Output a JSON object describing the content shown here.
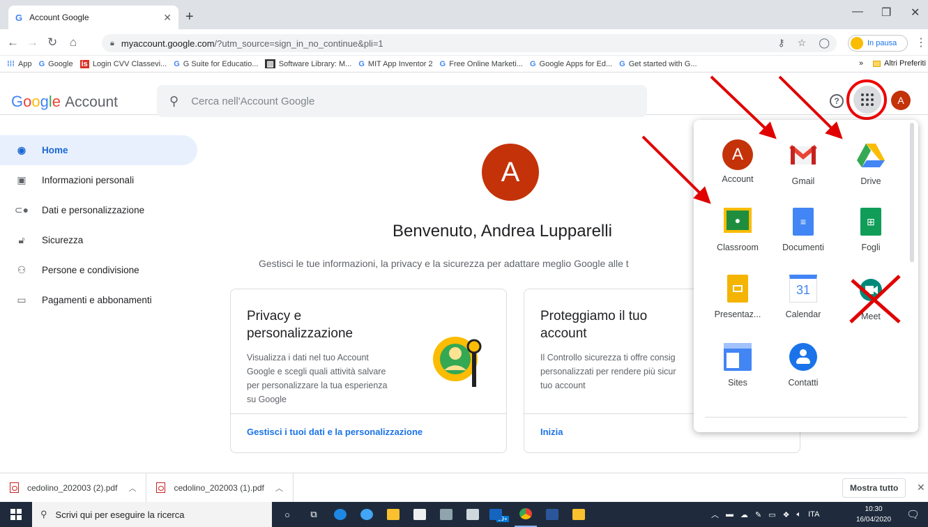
{
  "browser": {
    "tab_title": "Account Google",
    "tab_favicon": "G",
    "url_host": "myaccount.google.com",
    "url_path": "/?utm_source=sign_in_no_continue&pli=1",
    "profile_label": "In pausa",
    "bookmarks": [
      {
        "icon": "apps-icon",
        "label": "App"
      },
      {
        "icon": "G",
        "label": "Google"
      },
      {
        "icon": "is",
        "label": "Login CVV Classevi..."
      },
      {
        "icon": "G",
        "label": "G Suite for Educatio..."
      },
      {
        "icon": "library-icon",
        "label": "Software Library: M..."
      },
      {
        "icon": "G",
        "label": "MIT App Inventor 2"
      },
      {
        "icon": "G",
        "label": "Free Online Marketi..."
      },
      {
        "icon": "G",
        "label": "Google Apps for Ed..."
      },
      {
        "icon": "G",
        "label": "Get started with G..."
      }
    ],
    "bookmarks_more": "»",
    "other_bookmarks": "Altri Preferiti"
  },
  "header": {
    "logo_google": "Google",
    "logo_account": "Account",
    "search_placeholder": "Cerca nell'Account Google",
    "help": "?",
    "avatar_letter": "A"
  },
  "sidenav": {
    "items": [
      {
        "label": "Home",
        "icon": "home-icon"
      },
      {
        "label": "Informazioni personali",
        "icon": "id-card-icon"
      },
      {
        "label": "Dati e personalizzazione",
        "icon": "toggle-icon"
      },
      {
        "label": "Sicurezza",
        "icon": "lock-icon"
      },
      {
        "label": "Persone e condivisione",
        "icon": "people-icon"
      },
      {
        "label": "Pagamenti e abbonamenti",
        "icon": "credit-card-icon"
      }
    ]
  },
  "main": {
    "avatar_letter": "A",
    "welcome": "Benvenuto, Andrea Lupparelli",
    "subtitle": "Gestisci le tue informazioni, la privacy e la sicurezza per adattare meglio Google alle t",
    "cards": [
      {
        "title_line1": "Privacy e",
        "title_line2": "personalizzazione",
        "body": [
          "Visualizza i dati nel tuo Account",
          "Google e scegli quali attività salvare",
          "per personalizzare la tua esperienza",
          "su Google"
        ],
        "link": "Gestisci i tuoi dati e la personalizzazione"
      },
      {
        "title_line1": "Proteggiamo il tuo",
        "title_line2": "account",
        "body": [
          "Il Controllo sicurezza ti offre consig",
          "personalizzati per rendere più sicur",
          "tuo account"
        ],
        "link": "Inizia"
      }
    ]
  },
  "apps_panel": {
    "apps": [
      {
        "label": "Account",
        "icon": "account-icon"
      },
      {
        "label": "Gmail",
        "icon": "gmail-icon"
      },
      {
        "label": "Drive",
        "icon": "drive-icon"
      },
      {
        "label": "Classroom",
        "icon": "classroom-icon"
      },
      {
        "label": "Documenti",
        "icon": "docs-icon"
      },
      {
        "label": "Fogli",
        "icon": "sheets-icon"
      },
      {
        "label": "Presentaz...",
        "icon": "slides-icon"
      },
      {
        "label": "Calendar",
        "icon": "calendar-icon"
      },
      {
        "label": "Meet",
        "icon": "meet-icon"
      },
      {
        "label": "Sites",
        "icon": "sites-icon"
      },
      {
        "label": "Contatti",
        "icon": "contacts-icon"
      }
    ],
    "account_letter": "A",
    "calendar_day": "31"
  },
  "downloads": {
    "items": [
      "cedolino_202003 (2).pdf",
      "cedolino_202003 (1).pdf"
    ],
    "show_all": "Mostra tutto"
  },
  "taskbar": {
    "search_placeholder": "Scrivi qui per eseguire la ricerca",
    "badge": "99+",
    "lang": "ITA",
    "time": "10:30",
    "date": "16/04/2020"
  },
  "colors": {
    "accent": "#1a73e8",
    "avatar": "#c4320a",
    "annotation": "#e00000"
  }
}
